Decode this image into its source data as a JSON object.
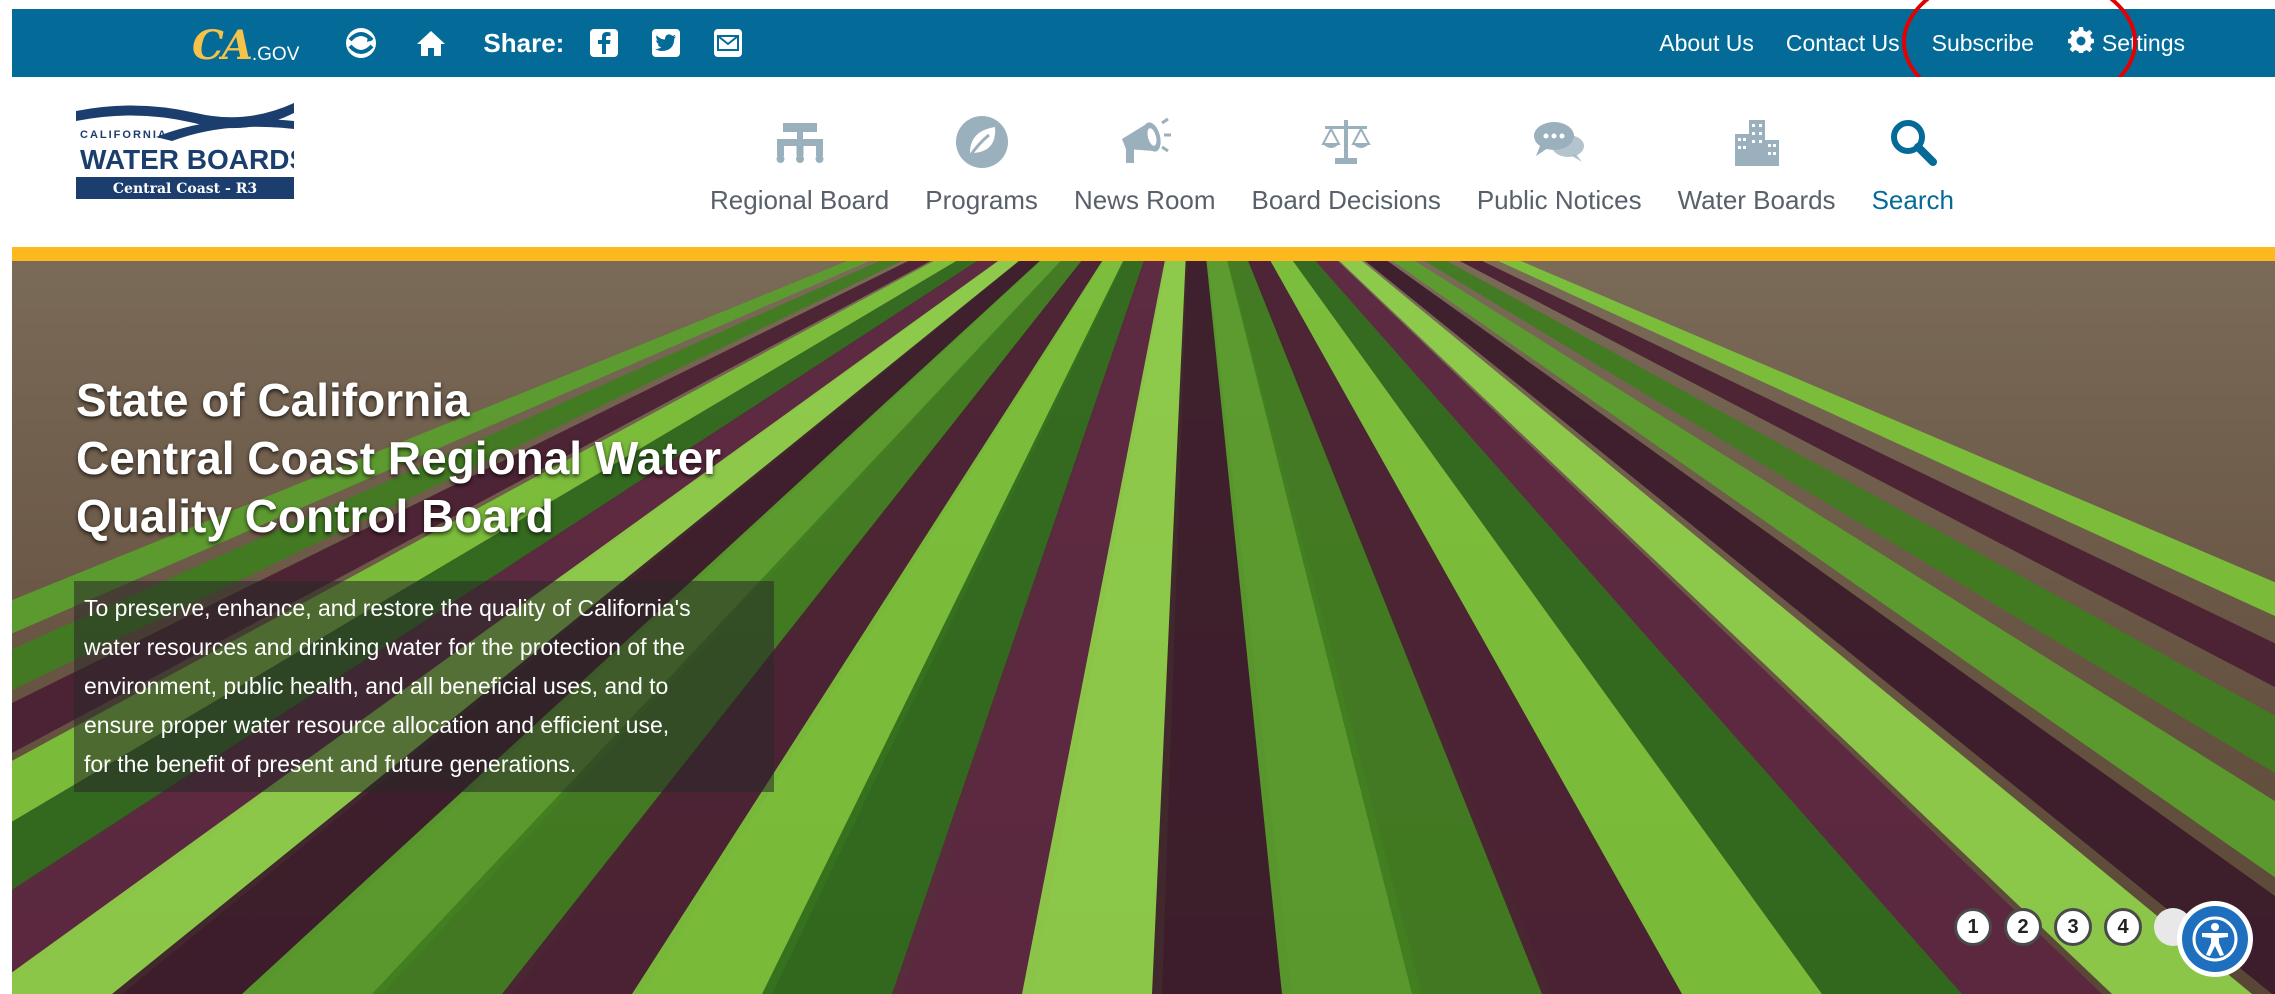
{
  "utility_bar": {
    "logo": {
      "ca": "CA",
      "gov": ".GOV"
    },
    "icons": [
      "cagov-logo",
      "translate-icon",
      "home-icon"
    ],
    "share_label": "Share:",
    "share_icons": [
      "facebook-icon",
      "twitter-icon",
      "email-icon"
    ],
    "links": {
      "about": "About Us",
      "contact": "Contact Us",
      "subscribe": "Subscribe",
      "settings": "Settings"
    },
    "colors": {
      "bar": "#046b99",
      "accent": "#fdb81e",
      "annotation": "#e30000"
    }
  },
  "org_logo": {
    "state": "CALIFORNIA",
    "name": "WATER BOARDS",
    "region": "Central Coast - R3"
  },
  "nav": {
    "items": [
      {
        "label": "Regional Board",
        "icon": "organization-chart-icon"
      },
      {
        "label": "Programs",
        "icon": "leaf-icon"
      },
      {
        "label": "News Room",
        "icon": "megaphone-icon"
      },
      {
        "label": "Board Decisions",
        "icon": "scales-icon"
      },
      {
        "label": "Public Notices",
        "icon": "chat-bubbles-icon"
      },
      {
        "label": "Water Boards",
        "icon": "buildings-icon"
      },
      {
        "label": "Search",
        "icon": "search-icon"
      }
    ]
  },
  "hero": {
    "title_lines": [
      "State of California",
      "Central Coast Regional Water",
      "Quality Control Board"
    ],
    "mission_lines": [
      "To preserve, enhance, and restore the quality of California's",
      "water resources and drinking water for the protection of the",
      "environment, public health, and all beneficial uses, and to",
      "ensure proper water resource allocation and efficient use,",
      "for the benefit of present and future generations."
    ],
    "slides": [
      "1",
      "2",
      "3",
      "4"
    ],
    "image_description_icon": "lettuce-field-image"
  }
}
